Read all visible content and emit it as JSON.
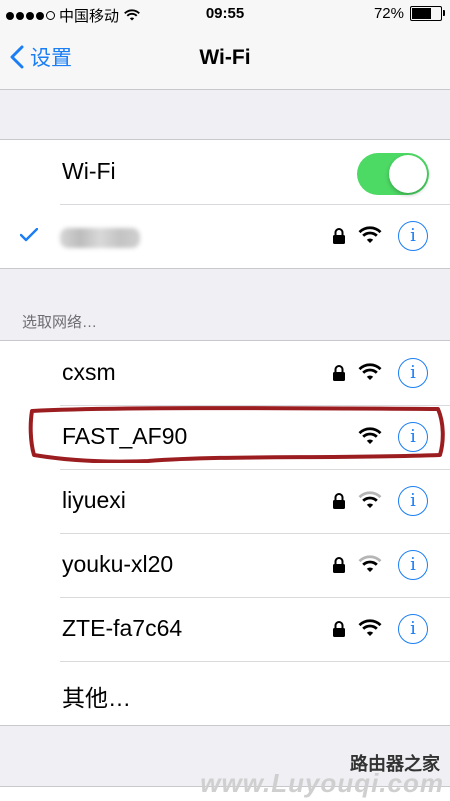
{
  "status_bar": {
    "carrier": "中国移动",
    "time": "09:55",
    "battery_percent": "72%",
    "battery_level": 0.72
  },
  "nav": {
    "back_label": "设置",
    "title": "Wi-Fi"
  },
  "wifi_toggle": {
    "label": "Wi-Fi",
    "enabled": true,
    "accent_color": "#4cd964"
  },
  "connected_network": {
    "name_blurred": true,
    "secured": true
  },
  "choose_network_header": "选取网络…",
  "networks": [
    {
      "name": "cxsm",
      "secured": true,
      "signal": "full"
    },
    {
      "name": "FAST_AF90",
      "secured": false,
      "signal": "full",
      "highlighted": true
    },
    {
      "name": "liyuexi",
      "secured": true,
      "signal": "medium"
    },
    {
      "name": "youku-xl20",
      "secured": true,
      "signal": "medium"
    },
    {
      "name": "ZTE-fa7c64",
      "secured": true,
      "signal": "full"
    }
  ],
  "other_label": "其他…",
  "watermark": {
    "site_name": "路由器之家",
    "url": "www.Luyouqi.com"
  },
  "colors": {
    "ios_blue": "#1a7ef5",
    "toggle_green": "#4cd964",
    "highlight_red": "#9b1d20"
  }
}
